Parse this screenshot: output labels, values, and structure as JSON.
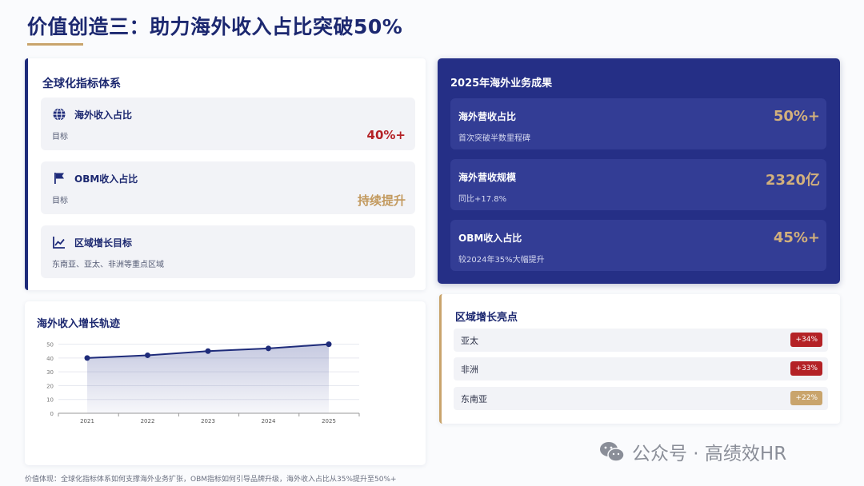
{
  "page": {
    "title": "价值创造三：助力海外收入占比突破50%",
    "footer": "价值体现：全球化指标体系如何支撑海外业务扩张，OBM指标如何引导品牌升级，海外收入占比从35%提升至50%+",
    "watermark": "公众号 · 高绩效HR"
  },
  "colors": {
    "navy": "#1e2b7a",
    "gold": "#c9a46c",
    "red": "#b42226"
  },
  "global_metrics": {
    "title": "全球化指标体系",
    "items": [
      {
        "icon": "globe-icon",
        "label": "海外收入占比",
        "sub": "目标",
        "value": "40%+"
      },
      {
        "icon": "flag-icon",
        "label": "OBM收入占比",
        "sub": "目标",
        "value": "持续提升"
      },
      {
        "icon": "trend-chart-icon",
        "label": "区域增长目标",
        "sub": "东南亚、亚太、非洲等重点区域",
        "value": ""
      }
    ]
  },
  "results": {
    "title": "2025年海外业务成果",
    "items": [
      {
        "label": "海外营收占比",
        "sub": "首次突破半数里程碑",
        "value": "50%+"
      },
      {
        "label": "海外营收规模",
        "sub": "同比+17.8%",
        "value": "2320亿"
      },
      {
        "label": "OBM收入占比",
        "sub": "较2024年35%大幅提升",
        "value": "45%+"
      }
    ]
  },
  "chart_data": {
    "type": "area",
    "title": "海外收入增长轨迹",
    "categories": [
      "2021",
      "2022",
      "2023",
      "2024",
      "2025"
    ],
    "values": [
      40,
      42,
      45,
      47,
      50
    ],
    "yticks": [
      0,
      10,
      20,
      30,
      40,
      50
    ],
    "ylim": [
      0,
      55
    ],
    "grid": true,
    "color": "#1e2b7a"
  },
  "regions": {
    "title": "区域增长亮点",
    "items": [
      {
        "name": "亚太",
        "badge": "+34%",
        "color": "#b42226"
      },
      {
        "name": "非洲",
        "badge": "+33%",
        "color": "#b42226"
      },
      {
        "name": "东南亚",
        "badge": "+22%",
        "color": "#c9a46c"
      }
    ]
  }
}
